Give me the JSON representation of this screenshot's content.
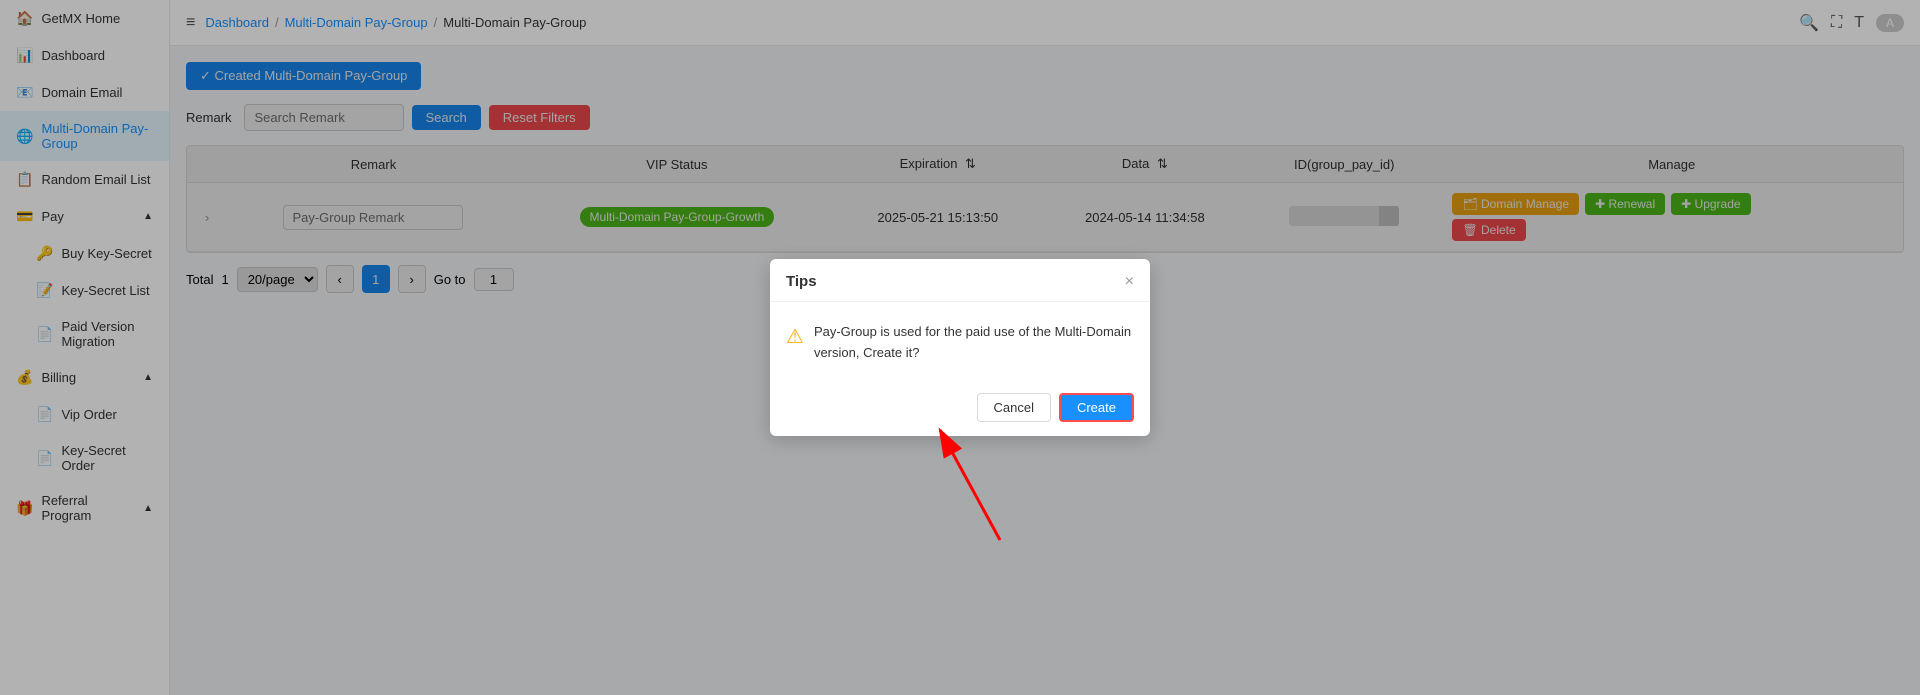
{
  "sidebar": {
    "logo": "GetMX Home",
    "items": [
      {
        "id": "getmx-home",
        "label": "GetMX Home",
        "icon": "🏠",
        "active": false,
        "indent": 0
      },
      {
        "id": "dashboard",
        "label": "Dashboard",
        "icon": "📊",
        "active": false,
        "indent": 0
      },
      {
        "id": "domain-email",
        "label": "Domain Email",
        "icon": "📧",
        "active": false,
        "indent": 0
      },
      {
        "id": "multi-domain",
        "label": "Multi-Domain Pay-Group",
        "icon": "🌐",
        "active": true,
        "indent": 0
      },
      {
        "id": "random-email",
        "label": "Random Email List",
        "icon": "📋",
        "active": false,
        "indent": 0
      },
      {
        "id": "pay",
        "label": "Pay",
        "icon": "💳",
        "active": false,
        "indent": 0,
        "expandable": true
      },
      {
        "id": "buy-key-secret",
        "label": "Buy Key-Secret",
        "icon": "🔑",
        "active": false,
        "indent": 1
      },
      {
        "id": "key-secret-list",
        "label": "Key-Secret List",
        "icon": "📝",
        "active": false,
        "indent": 1
      },
      {
        "id": "paid-version",
        "label": "Paid Version Migration",
        "icon": "📄",
        "active": false,
        "indent": 1
      },
      {
        "id": "billing",
        "label": "Billing",
        "icon": "💰",
        "active": false,
        "indent": 0,
        "expandable": true
      },
      {
        "id": "vip-order",
        "label": "Vip Order",
        "icon": "📄",
        "active": false,
        "indent": 1
      },
      {
        "id": "key-secret-order",
        "label": "Key-Secret Order",
        "icon": "📄",
        "active": false,
        "indent": 1
      },
      {
        "id": "referral",
        "label": "Referral Program",
        "icon": "🎁",
        "active": false,
        "indent": 0,
        "expandable": true
      }
    ]
  },
  "header": {
    "breadcrumb": [
      "Dashboard",
      "Multi-Domain Pay-Group",
      "Multi-Domain Pay-Group"
    ],
    "menu_icon": "≡",
    "search_icon": "🔍",
    "fullscreen_icon": "⛶",
    "type_icon": "T",
    "user_icon": "A"
  },
  "toolbar": {
    "created_btn": "✓ Created Multi-Domain Pay-Group"
  },
  "filter": {
    "label": "Remark",
    "placeholder": "Search Remark",
    "search_btn": "Search",
    "reset_btn": "Reset Filters"
  },
  "table": {
    "columns": [
      "Remark",
      "VIP Status",
      "Expiration",
      "Data",
      "ID(group_pay_id)",
      "Manage"
    ],
    "rows": [
      {
        "remark_placeholder": "Pay-Group Remark",
        "vip_status": "Multi-Domain Pay-Group-Growth",
        "expiration": "2025-05-21 15:13:50",
        "data": "2024-05-14 11:34:58",
        "id_bar": "",
        "manage": {
          "domain_manage": "🗂 Domain Manage",
          "renewal": "✚ Renewal",
          "upgrade": "✚ Upgrade",
          "delete": "🗑 Delete"
        }
      }
    ]
  },
  "pagination": {
    "total_label": "Total",
    "total": "1",
    "per_page": "20/page",
    "current_page": "1",
    "goto_label": "Go to",
    "goto_value": "1"
  },
  "modal": {
    "title": "Tips",
    "close": "×",
    "message": "Pay-Group is used for the paid use of the Multi-Domain version, Create it?",
    "cancel_btn": "Cancel",
    "create_btn": "Create"
  }
}
